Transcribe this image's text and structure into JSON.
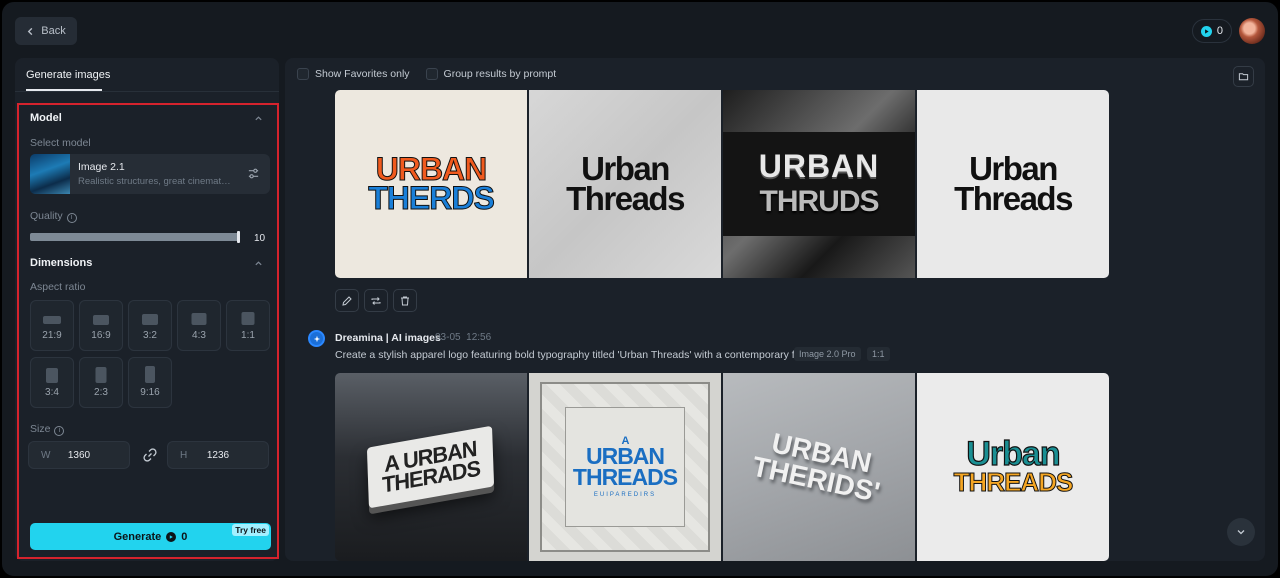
{
  "header": {
    "back_label": "Back",
    "credits": "0"
  },
  "left_panel": {
    "tab_label": "Generate images",
    "model": {
      "section_title": "Model",
      "select_label": "Select model",
      "name": "Image 2.1",
      "description": "Realistic structures, great cinematog..."
    },
    "quality": {
      "label": "Quality",
      "value": "10",
      "level": 1.0
    },
    "dimensions": {
      "section_title": "Dimensions",
      "aspect_label": "Aspect ratio",
      "ratios": [
        "21:9",
        "16:9",
        "3:2",
        "4:3",
        "1:1",
        "3:4",
        "2:3",
        "9:16"
      ],
      "size_label": "Size",
      "width_prefix": "W",
      "width": "1360",
      "height_prefix": "H",
      "height": "1236"
    },
    "generate": {
      "label": "Generate",
      "cost": "0",
      "badge": "Try free"
    }
  },
  "results": {
    "show_favorites_label": "Show Favorites only",
    "group_by_prompt_label": "Group results by prompt",
    "first_set": [
      {
        "line1": "URBAN",
        "line2": "THERDS"
      },
      {
        "line1": "Urban",
        "line2": "Threads"
      },
      {
        "line1": "URBAN",
        "line2": "THRUDS"
      },
      {
        "line1": "Urban",
        "line2": "Threads"
      }
    ],
    "second_group": {
      "author": "Dreamina | AI images",
      "date": "03-05",
      "time": "12:56",
      "prompt": "Create a stylish apparel logo featuring bold typography titled 'Urban Threads' with a contemporary flair.",
      "model_tag": "Image 2.0 Pro",
      "ratio_tag": "1:1",
      "images": [
        {
          "line1": "A URBAN",
          "line2": "THERADS"
        },
        {
          "line0": "A",
          "line1": "URBAN",
          "line2": "THREADS",
          "sub": "EUIPAREDIRS"
        },
        {
          "line1": "URBAN",
          "line2": "THERIDS'"
        },
        {
          "line1": "Urban",
          "line2": "THREADS"
        }
      ]
    }
  },
  "colors": {
    "accent": "#22d3ee",
    "highlight_border": "#d5232d",
    "background": "#151a20"
  }
}
